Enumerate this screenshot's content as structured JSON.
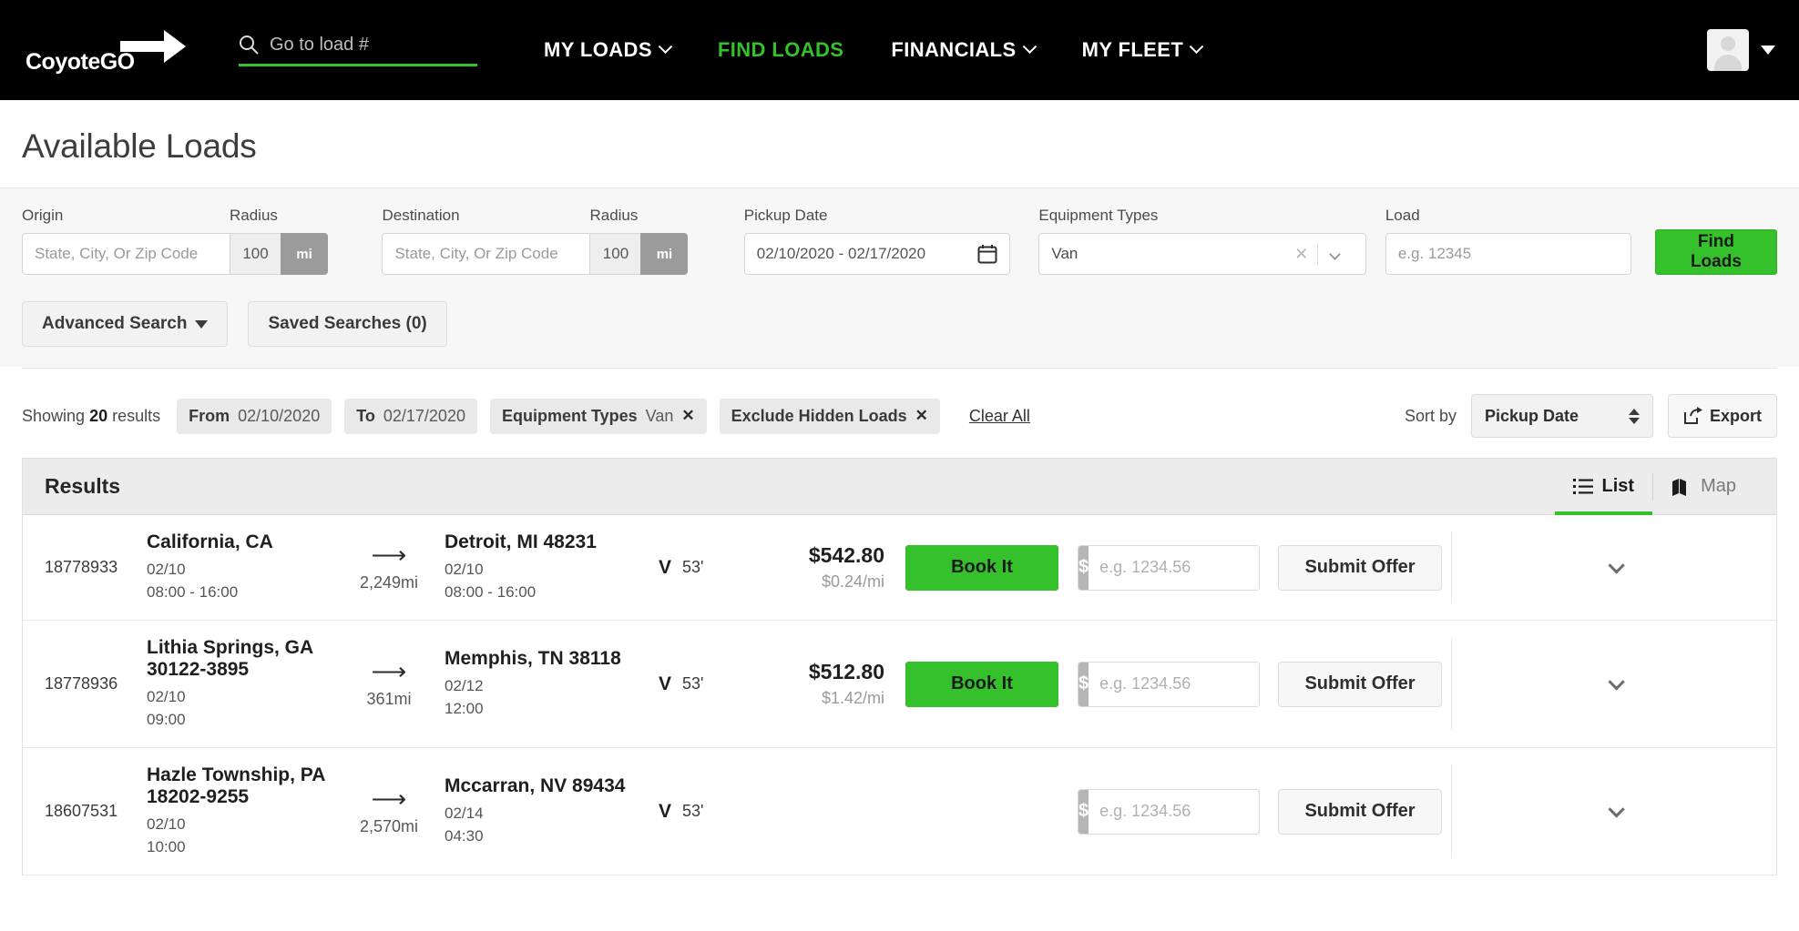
{
  "brand": {
    "logo_text": "CoyoteGO",
    "accent": "#35c12c"
  },
  "topnav": {
    "search_placeholder": "Go to load #",
    "search_value": "",
    "links": [
      {
        "label": "MY LOADS",
        "has_caret": true,
        "active": false
      },
      {
        "label": "FIND LOADS",
        "has_caret": false,
        "active": true
      },
      {
        "label": "FINANCIALS",
        "has_caret": true,
        "active": false
      },
      {
        "label": "MY FLEET",
        "has_caret": true,
        "active": false
      }
    ]
  },
  "page": {
    "title": "Available Loads"
  },
  "filters": {
    "origin": {
      "label": "Origin",
      "placeholder": "State, City, Or Zip Code",
      "value": ""
    },
    "origin_radius": {
      "label": "Radius",
      "value": "100",
      "unit": "mi"
    },
    "destination": {
      "label": "Destination",
      "placeholder": "State, City, Or Zip Code",
      "value": ""
    },
    "destination_radius": {
      "label": "Radius",
      "value": "100",
      "unit": "mi"
    },
    "pickup_date": {
      "label": "Pickup Date",
      "value": "02/10/2020 - 02/17/2020"
    },
    "equipment_types": {
      "label": "Equipment Types",
      "value": "Van"
    },
    "load": {
      "label": "Load",
      "placeholder": "e.g. 12345",
      "value": ""
    },
    "find_loads_label": "Find Loads",
    "advanced_search_label": "Advanced Search",
    "saved_searches_label": "Saved Searches (0)"
  },
  "resultsbar": {
    "showing_prefix": "Showing",
    "showing_count": "20",
    "showing_suffix": "results",
    "chips": [
      {
        "label": "From",
        "value": "02/10/2020",
        "removable": false
      },
      {
        "label": "To",
        "value": "02/17/2020",
        "removable": false
      },
      {
        "label": "Equipment Types",
        "value": "Van",
        "removable": true
      },
      {
        "label": "Exclude Hidden Loads",
        "value": "",
        "removable": true
      }
    ],
    "clear_all_label": "Clear All",
    "sort_by_label": "Sort by",
    "sort_by_value": "Pickup Date",
    "export_label": "Export"
  },
  "results": {
    "title": "Results",
    "views": [
      {
        "label": "List",
        "icon": "list-icon",
        "active": true
      },
      {
        "label": "Map",
        "icon": "map-icon",
        "active": false
      }
    ],
    "offer_placeholder": "e.g. 1234.56",
    "offer_currency": "$",
    "book_label": "Book It",
    "submit_offer_label": "Submit Offer",
    "rows": [
      {
        "id": "18778933",
        "origin_name": "California, CA",
        "origin_date": "02/10",
        "origin_time": "08:00 - 16:00",
        "distance": "2,249mi",
        "dest_name": "Detroit, MI 48231",
        "dest_date": "02/10",
        "dest_time": "08:00 - 16:00",
        "equip_letter": "V",
        "equip_size": "53'",
        "price": "$542.80",
        "rate_per_mile": "$0.24/mi",
        "has_book": true
      },
      {
        "id": "18778936",
        "origin_name": "Lithia Springs, GA 30122-3895",
        "origin_date": "02/10",
        "origin_time": "09:00",
        "distance": "361mi",
        "dest_name": "Memphis, TN 38118",
        "dest_date": "02/12",
        "dest_time": "12:00",
        "equip_letter": "V",
        "equip_size": "53'",
        "price": "$512.80",
        "rate_per_mile": "$1.42/mi",
        "has_book": true
      },
      {
        "id": "18607531",
        "origin_name": "Hazle Township, PA 18202-9255",
        "origin_date": "02/10",
        "origin_time": "10:00",
        "distance": "2,570mi",
        "dest_name": "Mccarran, NV 89434",
        "dest_date": "02/14",
        "dest_time": "04:30",
        "equip_letter": "V",
        "equip_size": "53'",
        "price": "",
        "rate_per_mile": "",
        "has_book": false
      }
    ]
  }
}
